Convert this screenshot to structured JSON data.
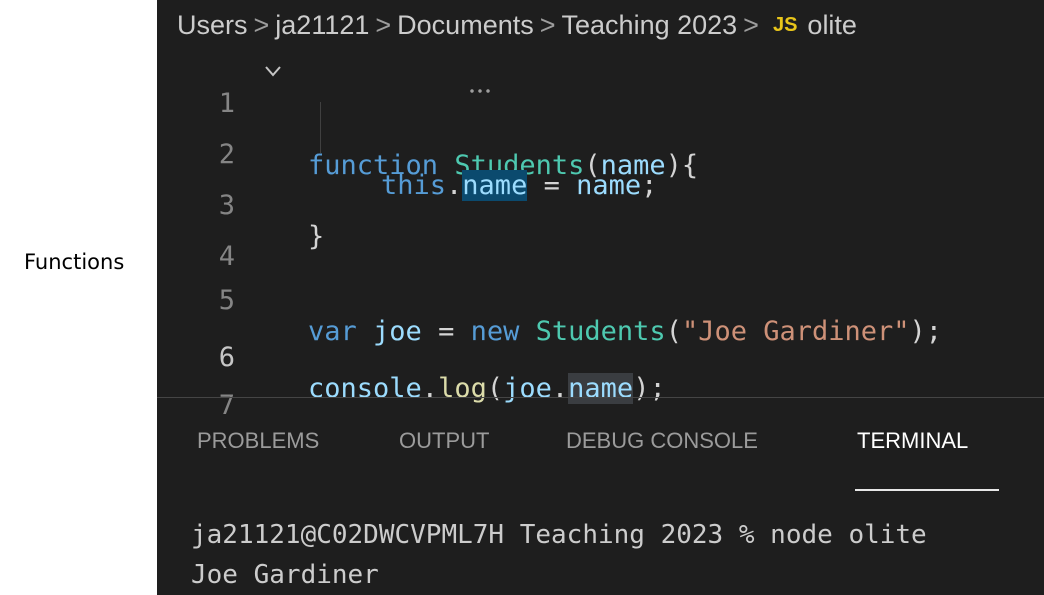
{
  "side_label": "Functions",
  "breadcrumb": {
    "items": [
      "Users",
      "ja21121",
      "Documents",
      "Teaching 2023"
    ],
    "separator": ">",
    "file_badge": "JS",
    "file_name": "olite"
  },
  "editor": {
    "line_numbers": [
      "1",
      "2",
      "3",
      "4",
      "5",
      "6",
      "7"
    ],
    "active_line": 6,
    "code": {
      "l1_kw": "function",
      "l1_fn": "Students",
      "l1_open": "(",
      "l1_param": "name",
      "l1_close": "){",
      "l2_this": "this",
      "l2_dot": ".",
      "l2_prop": "name",
      "l2_eq": " = ",
      "l2_val": "name",
      "l2_semi": ";",
      "l3": "}",
      "l5_var": "var",
      "l5_name": " joe",
      "l5_eq": " = ",
      "l5_new": "new",
      "l5_cls": " Students",
      "l5_open": "(",
      "l5_str": "\"Joe Gardiner\"",
      "l5_close": ");",
      "l6_obj": "console",
      "l6_dot": ".",
      "l6_fn": "log",
      "l6_open": "(",
      "l6_arg": "joe",
      "l6_dot2": ".",
      "l6_prop": "name",
      "l6_close": ");"
    }
  },
  "panel": {
    "tabs": [
      "PROBLEMS",
      "OUTPUT",
      "DEBUG CONSOLE",
      "TERMINAL"
    ],
    "active_tab": "TERMINAL"
  },
  "terminal": {
    "prompt_line": "ja21121@C02DWCVPML7H Teaching 2023 % node olite",
    "output_line": "Joe Gardiner"
  },
  "colors": {
    "editor_bg": "#1e1e1e",
    "keyword": "#569cd6",
    "class_name": "#4ec9b0",
    "function_name": "#dcdcaa",
    "variable": "#9cdcfe",
    "string": "#ce9178",
    "js_badge": "#e8c51a"
  }
}
